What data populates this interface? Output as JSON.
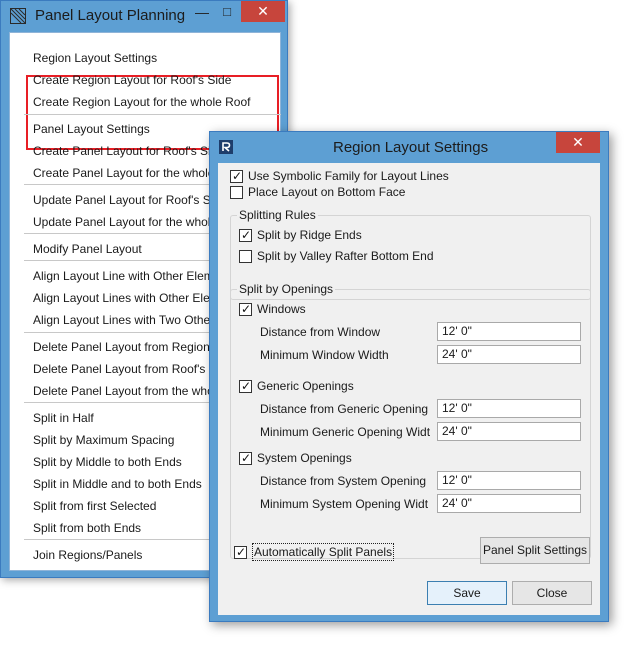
{
  "panel_window": {
    "title": "Panel Layout Planning",
    "icon": "grid-hatch-icon",
    "controls": {
      "minimize": "—",
      "maximize": "□",
      "close": "✕"
    },
    "menu": [
      "Region Layout Settings",
      "Create Region Layout for Roof's Side",
      "Create Region Layout for the whole Roof",
      "Panel Layout Settings",
      "Create Panel Layout for Roof's Side",
      "Create Panel Layout for the whole Roof",
      "Update Panel Layout for Roof's Side",
      "Update Panel Layout for the whole Roof",
      "Modify Panel Layout",
      "Align Layout Line with Other Element",
      "Align Layout Lines with Other Element",
      "Align Layout Lines with Two Other Elements",
      "Delete Panel Layout from Region",
      "Delete Panel Layout from Roof's Side",
      "Delete Panel Layout from the whole Roof",
      "Split in Half",
      "Split by Maximum Spacing",
      "Split by Middle to both Ends",
      "Split in Middle and to both Ends",
      "Split from first Selected",
      "Split from both Ends",
      "Join Regions/Panels"
    ],
    "highlight_color": "#e81e25"
  },
  "dialog": {
    "title": "Region Layout Settings",
    "icon": "revit-r-icon",
    "close": "✕",
    "use_symbolic": {
      "label": "Use Symbolic Family for Layout Lines",
      "checked": true
    },
    "place_bottom": {
      "label": "Place Layout on Bottom Face",
      "checked": false
    },
    "splitting_rules": {
      "title": "Splitting Rules",
      "ridge": {
        "label": "Split by Ridge Ends",
        "checked": true
      },
      "valley": {
        "label": "Split by Valley Rafter Bottom End",
        "checked": false
      }
    },
    "split_openings": {
      "title": "Split by Openings",
      "windows": {
        "label": "Windows",
        "checked": true,
        "distance_label": "Distance from Window",
        "distance_value": "12'  0\"",
        "min_label": "Minimum Window Width",
        "min_value": "24'  0\""
      },
      "generic": {
        "label": "Generic Openings",
        "checked": true,
        "distance_label": "Distance from Generic Opening",
        "distance_value": "12'  0\"",
        "min_label": "Minimum Generic Opening Widt",
        "min_value": "24'  0\""
      },
      "system": {
        "label": "System Openings",
        "checked": true,
        "distance_label": "Distance from System Opening",
        "distance_value": "12'  0\"",
        "min_label": "Minimum System Opening Widt",
        "min_value": "24'  0\""
      }
    },
    "auto_split": {
      "label": "Automatically Split Panels",
      "checked": true
    },
    "panel_split_settings": "Panel Split Settings",
    "save": "Save",
    "close_button": "Close"
  }
}
